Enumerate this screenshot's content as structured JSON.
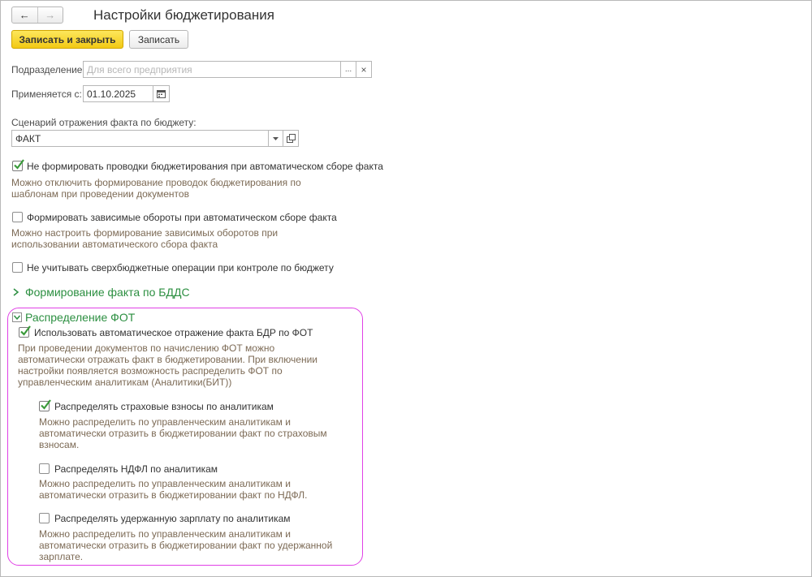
{
  "window": {
    "title": "Настройки бюджетирования"
  },
  "nav": {
    "back_icon": "arrow-left-icon",
    "forward_icon": "arrow-right-icon"
  },
  "toolbar": {
    "save_close_label": "Записать и закрыть",
    "save_label": "Записать"
  },
  "subdivision": {
    "label": "Подразделение:",
    "placeholder": "Для всего предприятия",
    "select_button": "...",
    "clear_button": "×"
  },
  "applies_from": {
    "label": "Применяется с:",
    "value": "01.10.2025",
    "icon": "calendar-icon"
  },
  "scenario": {
    "label": "Сценарий отражения факта по бюджету:",
    "value": "ФАКТ",
    "dropdown_icon": "dropdown-arrow-icon",
    "open_icon": "open-window-icon"
  },
  "options": [
    {
      "label": "Не формировать проводки бюджетирования при автоматическом сборе факта",
      "checked": true,
      "hint": [
        "Можно отключить формирование проводок бюджетирования по",
        "шаблонам при проведении документов"
      ]
    },
    {
      "label": "Формировать зависимые обороты при автоматическом сборе факта",
      "checked": false,
      "hint": [
        "Можно настроить формирование зависимых оборотов при",
        "использовании автоматического сбора факта"
      ]
    },
    {
      "label": "Не учитывать сверхбюджетные операции при контроле по бюджету",
      "checked": false,
      "hint": []
    }
  ],
  "group_bdds": {
    "title": "Формирование факта по БДДС",
    "expanded": false
  },
  "group_fot": {
    "title": "Распределение ФОТ",
    "expanded": true,
    "main_option": {
      "label": "Использовать автоматическое отражение факта БДР по ФОТ",
      "checked": true,
      "hint": [
        "При проведении документов по начислению ФОТ можно",
        "автоматически отражать факт в бюджетировании. При включении",
        "настройки появляется возможность распределить ФОТ по",
        "управленческим аналитикам (Аналитики(БИТ))"
      ]
    },
    "sub_options": [
      {
        "label": "Распределять страховые взносы по аналитикам",
        "checked": true,
        "hint": [
          "Можно распределить по управленческим аналитикам и",
          "автоматически отразить в бюджетировании факт по страховым",
          "взносам."
        ]
      },
      {
        "label": "Распределять НДФЛ по аналитикам",
        "checked": false,
        "hint": [
          "Можно распределить по управленческим аналитикам и",
          "автоматически отразить в бюджетировании факт по НДФЛ."
        ]
      },
      {
        "label": "Распределять удержанную зарплату по аналитикам",
        "checked": false,
        "hint": [
          "Можно распределить по управленческим аналитикам и",
          "автоматически отразить в бюджетировании факт по удержанной",
          "зарплате."
        ]
      }
    ]
  },
  "colors": {
    "accent_green": "#2c8f41",
    "checkmark_green": "#3a9a3a",
    "hint_text": "#7c6a55",
    "primary_button": "#f2c914",
    "highlight_outline": "#e040e6"
  }
}
